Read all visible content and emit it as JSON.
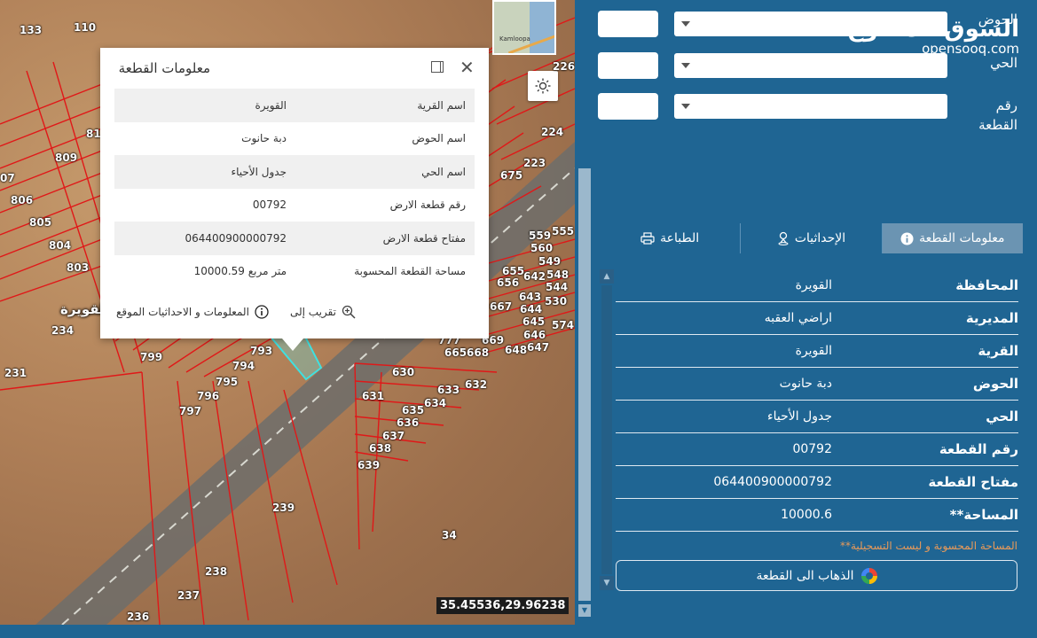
{
  "map": {
    "plots": [
      {
        "n": "133",
        "l": 22,
        "t": 28
      },
      {
        "n": "110",
        "l": 83,
        "t": 25
      },
      {
        "n": "226",
        "l": 623,
        "t": 69
      },
      {
        "n": "81",
        "l": 97,
        "t": 145
      },
      {
        "n": "809",
        "l": 62,
        "t": 172
      },
      {
        "n": "07",
        "l": 0,
        "t": 195
      },
      {
        "n": "806",
        "l": 12,
        "t": 220
      },
      {
        "n": "805",
        "l": 33,
        "t": 245
      },
      {
        "n": "804",
        "l": 55,
        "t": 271
      },
      {
        "n": "803",
        "l": 75,
        "t": 296
      },
      {
        "n": "234",
        "l": 58,
        "t": 367
      },
      {
        "n": "799",
        "l": 158,
        "t": 397
      },
      {
        "n": "794",
        "l": 262,
        "t": 407
      },
      {
        "n": "793",
        "l": 282,
        "t": 390
      },
      {
        "n": "795",
        "l": 243,
        "t": 425
      },
      {
        "n": "796",
        "l": 222,
        "t": 441
      },
      {
        "n": "797",
        "l": 202,
        "t": 458
      },
      {
        "n": "231",
        "l": 5,
        "t": 415
      },
      {
        "n": "224",
        "l": 610,
        "t": 143
      },
      {
        "n": "223",
        "l": 590,
        "t": 178
      },
      {
        "n": "675",
        "l": 564,
        "t": 192
      },
      {
        "n": "559",
        "l": 596,
        "t": 260
      },
      {
        "n": "555",
        "l": 622,
        "t": 255
      },
      {
        "n": "560",
        "l": 598,
        "t": 274
      },
      {
        "n": "549",
        "l": 607,
        "t": 289
      },
      {
        "n": "548",
        "l": 616,
        "t": 304
      },
      {
        "n": "655",
        "l": 566,
        "t": 300
      },
      {
        "n": "642",
        "l": 590,
        "t": 306
      },
      {
        "n": "656",
        "l": 560,
        "t": 313
      },
      {
        "n": "544",
        "l": 615,
        "t": 318
      },
      {
        "n": "643",
        "l": 585,
        "t": 329
      },
      {
        "n": "530",
        "l": 614,
        "t": 334
      },
      {
        "n": "667",
        "l": 552,
        "t": 340
      },
      {
        "n": "644",
        "l": 586,
        "t": 343
      },
      {
        "n": "645",
        "l": 589,
        "t": 357
      },
      {
        "n": "574",
        "l": 622,
        "t": 361
      },
      {
        "n": "646",
        "l": 590,
        "t": 372
      },
      {
        "n": "669",
        "l": 543,
        "t": 378
      },
      {
        "n": "647",
        "l": 594,
        "t": 386
      },
      {
        "n": "777",
        "l": 494,
        "t": 378
      },
      {
        "n": "665",
        "l": 501,
        "t": 392
      },
      {
        "n": "668",
        "l": 526,
        "t": 392
      },
      {
        "n": "648",
        "l": 569,
        "t": 389
      },
      {
        "n": "630",
        "l": 442,
        "t": 414
      },
      {
        "n": "633",
        "l": 493,
        "t": 434
      },
      {
        "n": "632",
        "l": 524,
        "t": 428
      },
      {
        "n": "631",
        "l": 408,
        "t": 441
      },
      {
        "n": "634",
        "l": 478,
        "t": 449
      },
      {
        "n": "635",
        "l": 453,
        "t": 457
      },
      {
        "n": "636",
        "l": 447,
        "t": 471
      },
      {
        "n": "637",
        "l": 431,
        "t": 486
      },
      {
        "n": "638",
        "l": 416,
        "t": 500
      },
      {
        "n": "639",
        "l": 403,
        "t": 519
      },
      {
        "n": "239",
        "l": 307,
        "t": 567
      },
      {
        "n": "34",
        "l": 498,
        "t": 598
      },
      {
        "n": "238",
        "l": 231,
        "t": 639
      },
      {
        "n": "237",
        "l": 200,
        "t": 666
      },
      {
        "n": "236",
        "l": 143,
        "t": 690
      }
    ],
    "area_label": "القويرة",
    "minimap_label": "Kamloopa",
    "coordinates": "35.45536,29.96238"
  },
  "popup": {
    "title": "معلومات القطعة",
    "rows": [
      {
        "k": "اسم القرية",
        "v": "القويرة"
      },
      {
        "k": "اسم الحوض",
        "v": "دبة حانوت"
      },
      {
        "k": "اسم الحي",
        "v": "جدول الأحياء"
      },
      {
        "k": "رقم قطعة الارض",
        "v": "00792"
      },
      {
        "k": "مفتاح قطعة الارض",
        "v": "064400900000792"
      },
      {
        "k": "مساحة القطعة المحسوبة",
        "v": "10000.59 متر مربع"
      }
    ],
    "zoom_label": "تقريب إلى",
    "info_label": "المعلومات و الاحداثيات الموقع"
  },
  "panel": {
    "logo_ar": "السوق المفتوح",
    "logo_en": "opensooq.com",
    "labels": {
      "basin": "الحوض",
      "district": "الحي",
      "plot_no_1": "رقم",
      "plot_no_2": "القطعة"
    },
    "tabs": [
      {
        "label": "الطباعة",
        "icon": "printer-icon"
      },
      {
        "label": "الإحداثيات",
        "icon": "location-icon"
      },
      {
        "label": "معلومات القطعة",
        "icon": "info-icon"
      }
    ],
    "info_rows": [
      {
        "k": "المحافظة",
        "v": "القويرة"
      },
      {
        "k": "المديرية",
        "v": "اراضي العقبه"
      },
      {
        "k": "القرية",
        "v": "القويرة"
      },
      {
        "k": "الحوض",
        "v": "دبة حانوت"
      },
      {
        "k": "الحي",
        "v": "جدول الأحياء"
      },
      {
        "k": "رقم القطعة",
        "v": "00792"
      },
      {
        "k": "مفتاح القطعة",
        "v": "064400900000792"
      },
      {
        "k": "**المساحة",
        "v": "10000.6"
      }
    ],
    "note": "**المساحة المحسوبة و ليست التسجيلية",
    "goto_label": "الذهاب الى القطعة"
  }
}
